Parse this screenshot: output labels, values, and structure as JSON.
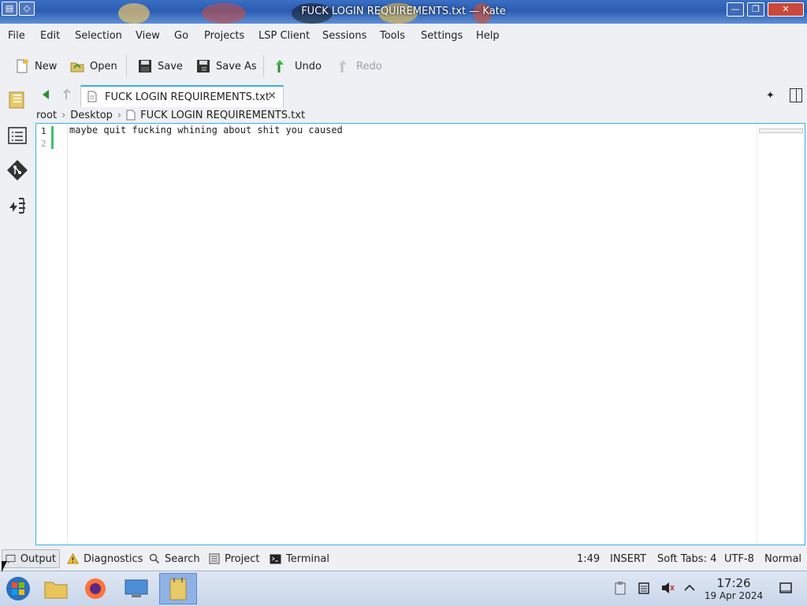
{
  "window": {
    "title": "FUCK LOGIN REQUIREMENTS.txt — Kate",
    "controls": {
      "minimize": "—",
      "maximize": "❐",
      "close": "✕"
    }
  },
  "menu": [
    "File",
    "Edit",
    "Selection",
    "View",
    "Go",
    "Projects",
    "LSP Client",
    "Sessions",
    "Tools",
    "Settings",
    "Help"
  ],
  "toolbar": {
    "new_label": "New",
    "open_label": "Open",
    "save_label": "Save",
    "save_as_label": "Save As",
    "undo_label": "Undo",
    "redo_label": "Redo"
  },
  "tabs": [
    {
      "label": "FUCK LOGIN REQUIREMENTS.txt",
      "close": "✕"
    }
  ],
  "breadcrumb": [
    "root",
    "Desktop",
    "FUCK LOGIN REQUIREMENTS.txt"
  ],
  "editor": {
    "line_numbers": [
      "1",
      "2"
    ],
    "lines": [
      "maybe quit fucking whining about shit you caused",
      ""
    ]
  },
  "bottom_tabs": [
    "Output",
    "Diagnostics",
    "Search",
    "Project",
    "Terminal"
  ],
  "status": {
    "cursor": "1:49",
    "mode": "INSERT",
    "indent": "Soft Tabs: 4",
    "encoding": "UTF-8",
    "input_mode": "Normal"
  },
  "clock": {
    "time": "17:26",
    "date": "19 Apr 2024"
  },
  "colors": {
    "accent": "#3daee9",
    "modified_line": "#3ec26e",
    "titlebar": "#2b5cb0"
  }
}
